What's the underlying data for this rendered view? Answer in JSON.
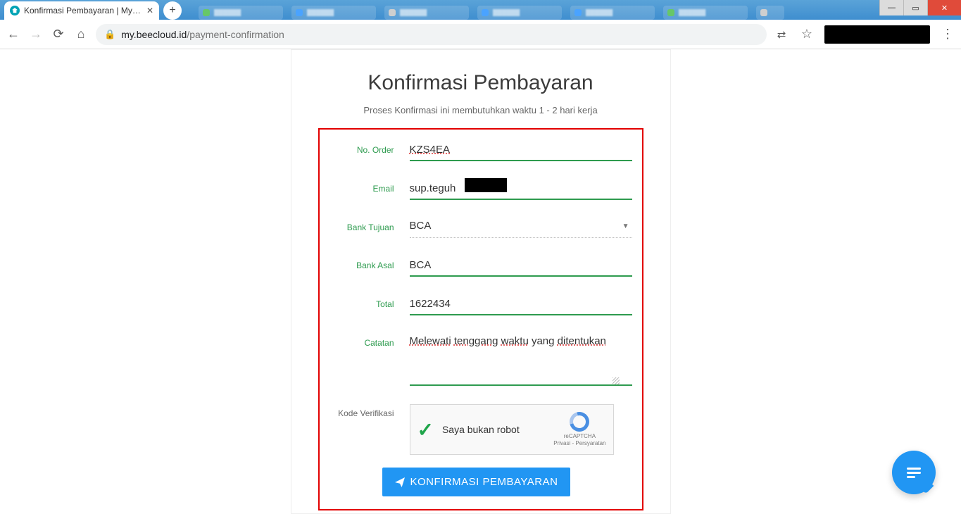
{
  "browser": {
    "tab_title": "Konfirmasi Pembayaran | My Bee",
    "url_domain": "my.beecloud.id",
    "url_path": "/payment-confirmation"
  },
  "page": {
    "title": "Konfirmasi Pembayaran",
    "subtitle": "Proses Konfirmasi ini membutuhkan waktu 1 - 2 hari kerja"
  },
  "form": {
    "no_order": {
      "label": "No. Order",
      "value": "KZS4EA"
    },
    "email": {
      "label": "Email",
      "value": "sup.teguh"
    },
    "bank_tujuan": {
      "label": "Bank Tujuan",
      "value": "BCA"
    },
    "bank_asal": {
      "label": "Bank Asal",
      "value": "BCA"
    },
    "total": {
      "label": "Total",
      "value": "1622434"
    },
    "catatan": {
      "label": "Catatan",
      "value": "Melewati tenggang waktu yang ditentukan"
    },
    "verifikasi": {
      "label": "Kode Verifikasi"
    }
  },
  "recaptcha": {
    "text": "Saya bukan robot",
    "brand": "reCAPTCHA",
    "legal": "Privasi - Persyaratan"
  },
  "submit_label": "KONFIRMASI PEMBAYARAN"
}
